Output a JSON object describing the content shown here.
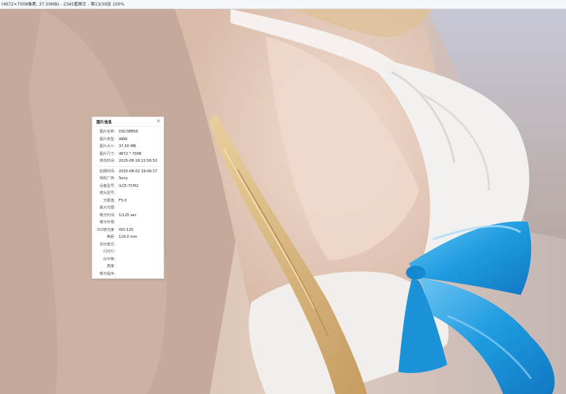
{
  "window": {
    "title": "(4672×7008像素, 37.50MB) - 2345看图王 - 第13/39张 100%"
  },
  "info_panel": {
    "title": "图片信息",
    "close_icon": "close-icon",
    "file_info": [
      {
        "label": "图片名称:",
        "value": "DSC08856"
      },
      {
        "label": "图片类型:",
        "value": "ARW"
      },
      {
        "label": "图片大小:",
        "value": "37.50 MB"
      },
      {
        "label": "图片尺寸:",
        "value": "4672 * 7008"
      },
      {
        "label": "修改时间:",
        "value": "2025-08-18 22:56:52"
      }
    ],
    "exif_info": [
      {
        "label": "拍摄时间:",
        "value": "2025-08-02 19:06:17"
      },
      {
        "label": "相机厂商:",
        "value": "Sony"
      },
      {
        "label": "设备型号:",
        "value": "ILCE-7CM2"
      },
      {
        "label": "镜头型号:",
        "value": ""
      },
      {
        "label": "光圈值:",
        "value": "F5.0"
      },
      {
        "label": "最大光圈:",
        "value": ""
      },
      {
        "label": "曝光时间:",
        "value": "1/125 sec"
      },
      {
        "label": "曝光补偿:",
        "value": ""
      },
      {
        "label": "ISO感光度:",
        "value": "ISO-125"
      },
      {
        "label": "焦距:",
        "value": "116.0 mm"
      },
      {
        "label": "测光模式:",
        "value": ""
      },
      {
        "label": "闪光灯:",
        "value": ""
      },
      {
        "label": "白平衡:",
        "value": ""
      },
      {
        "label": "亮度:",
        "value": ""
      },
      {
        "label": "曝光程序:",
        "value": ""
      }
    ]
  }
}
